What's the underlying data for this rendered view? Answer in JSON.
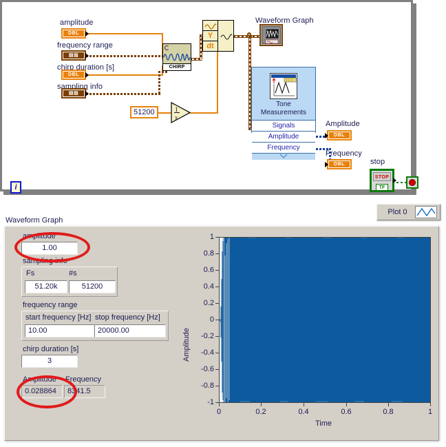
{
  "block_diagram": {
    "labels": {
      "amplitude": "amplitude",
      "frequency_range": "frequency range",
      "chirp_duration": "chirp duration [s]",
      "sampling_info": "sampling info",
      "waveform_graph": "Waveform Graph",
      "amplitude_out": "Amplitude",
      "frequency_out": "Frequency",
      "stop": "stop"
    },
    "terminals": {
      "dbl": "DBL",
      "cluster": "⬛⬛"
    },
    "constant": "51200",
    "chirp_node_label": "CHIRP",
    "build_waveform": {
      "y": "Y",
      "dt": "dt"
    },
    "express_vi": {
      "title_line1": "Tone",
      "title_line2": "Measurements",
      "rows": [
        "Signals",
        "Amplitude",
        "Frequency"
      ]
    },
    "stop_button": {
      "glyph": "STOP",
      "datatype": "TF"
    },
    "iteration_terminal": "i"
  },
  "front_panel": {
    "graph_title": "Waveform Graph",
    "legend": {
      "label": "Plot 0",
      "icon": "waveform-line-icon"
    },
    "controls": {
      "amplitude": {
        "label": "amplitude",
        "value": "1.00"
      },
      "sampling_info": {
        "label": "sampling info",
        "columns": [
          "Fs",
          "#s"
        ],
        "values": [
          "51.20k",
          "51200"
        ]
      },
      "frequency_range": {
        "label": "frequency range",
        "columns": [
          "start frequency [Hz]",
          "stop frequency [Hz]"
        ],
        "values": [
          "10.00",
          "20000.00"
        ]
      },
      "chirp_duration": {
        "label": "chirp duration [s]",
        "value": "3"
      }
    },
    "indicators": {
      "amplitude": {
        "label": "Amplitude",
        "value": "0.028864"
      },
      "frequency": {
        "label": "Frequency",
        "value": "8341.5"
      }
    }
  },
  "chart_data": {
    "type": "area",
    "title": "Waveform Graph",
    "xlabel": "Time",
    "ylabel": "Amplitude",
    "xlim": [
      0,
      1
    ],
    "ylim": [
      -1,
      1
    ],
    "xticks": [
      "0",
      "0.2",
      "0.4",
      "0.6",
      "0.8",
      "1"
    ],
    "yticks": [
      "1",
      "0.8",
      "0.6",
      "0.4",
      "0.2",
      "0",
      "-0.2",
      "-0.4",
      "-0.6",
      "-0.8",
      "-1"
    ],
    "grid": false,
    "legend": [
      "Plot 0"
    ],
    "series": [
      {
        "name": "Plot 0",
        "description": "Dense chirp waveform filling plot area, amplitude 1.0",
        "color": "#0D5A9E",
        "x": [
          0,
          0.002,
          0.004,
          0.006,
          0.008,
          0.01,
          0.012,
          0.015,
          0.02,
          0.03,
          0.05,
          0.1,
          0.2,
          0.3,
          0.4,
          0.5,
          0.6,
          0.7,
          0.8,
          0.9,
          1.0
        ],
        "envelope_upper": [
          0,
          0.2,
          0.78,
          1,
          1,
          1,
          1,
          1,
          1,
          1,
          1,
          1,
          1,
          1,
          1,
          1,
          1,
          1,
          1,
          1,
          1
        ],
        "envelope_lower": [
          0,
          -0.12,
          -0.45,
          -1,
          -1,
          -1,
          -1,
          -1,
          -1,
          -1,
          -1,
          -1,
          -1,
          -1,
          -1,
          -1,
          -1,
          -1,
          -1,
          -1,
          -1
        ]
      }
    ]
  },
  "annotations": {
    "ellipse_amplitude_control": "red-ellipse-amplitude",
    "ellipse_amplitude_indicator": "red-ellipse-amplitude-indicator",
    "color": "#e01b1b"
  }
}
